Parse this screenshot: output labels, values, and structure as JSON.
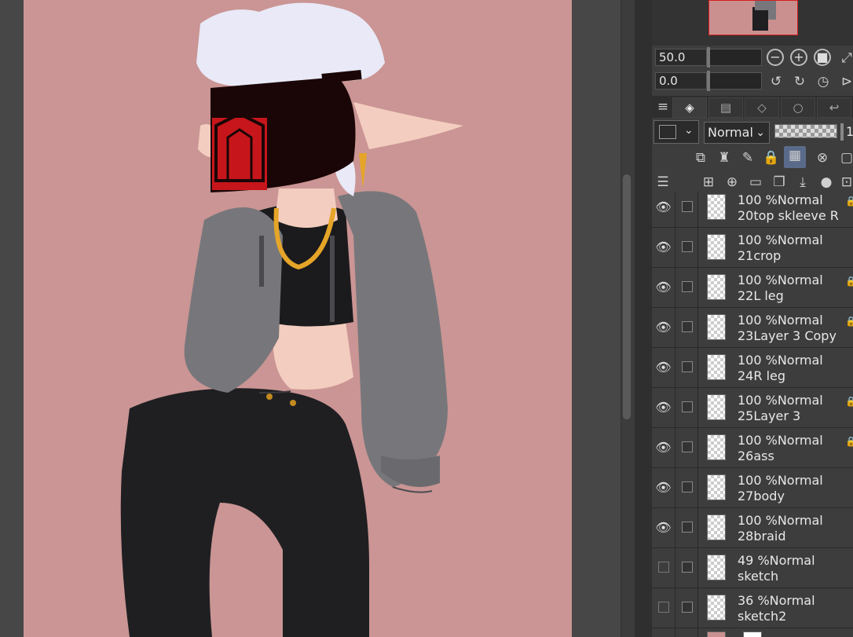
{
  "navigator": {
    "zoom_value": "50.0",
    "rotate_value": "0.0",
    "zoom_out_icon": "zoom-out-icon",
    "zoom_in_icon": "zoom-in-icon",
    "fit_icon": "fit-icon",
    "rotate_left_icon": "rotate-left-icon",
    "rotate_right_icon": "rotate-right-icon",
    "reset_rotation_icon": "reset-rotation-icon"
  },
  "layer_panel": {
    "blend_mode": "Normal",
    "opacity_partial": "1"
  },
  "layers": [
    {
      "opacity": "100 %",
      "mode": "Normal",
      "name": "20top skleeve R",
      "visible": true,
      "locked": true
    },
    {
      "opacity": "100 %",
      "mode": "Normal",
      "name": "21crop",
      "visible": true,
      "locked": false
    },
    {
      "opacity": "100 %",
      "mode": "Normal",
      "name": "22L leg",
      "visible": true,
      "locked": true
    },
    {
      "opacity": "100 %",
      "mode": "Normal",
      "name": "23Layer 3 Copy",
      "visible": true,
      "locked": true
    },
    {
      "opacity": "100 %",
      "mode": "Normal",
      "name": "24R leg",
      "visible": true,
      "locked": false
    },
    {
      "opacity": "100 %",
      "mode": "Normal",
      "name": "25Layer 3",
      "visible": true,
      "locked": true
    },
    {
      "opacity": "100 %",
      "mode": "Normal",
      "name": "26ass",
      "visible": true,
      "locked": true
    },
    {
      "opacity": "100 %",
      "mode": "Normal",
      "name": "27body",
      "visible": true,
      "locked": false
    },
    {
      "opacity": "100 %",
      "mode": "Normal",
      "name": "28braid",
      "visible": true,
      "locked": false
    },
    {
      "opacity": "49 %",
      "mode": "Normal",
      "name": "sketch",
      "visible": false,
      "locked": false
    },
    {
      "opacity": "36 %",
      "mode": "Normal",
      "name": "sketch2",
      "visible": false,
      "locked": false
    }
  ],
  "colors": {
    "canvas_bg": "#ca9594",
    "panel_bg": "#3d3d3d",
    "hoodie": "#77777b",
    "pants": "#1f1f22",
    "hair": "#e9e9f7",
    "mask": "#1a0606",
    "mask_glow": "#c7161b",
    "chain": "#e5a528"
  }
}
